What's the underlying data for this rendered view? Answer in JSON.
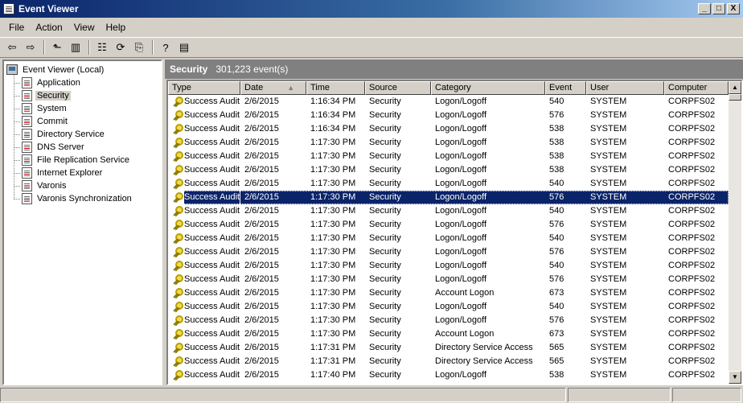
{
  "window": {
    "title": "Event Viewer",
    "controls": [
      "_",
      "□",
      "X"
    ]
  },
  "menu": [
    "File",
    "Action",
    "View",
    "Help"
  ],
  "toolbar": {
    "buttons": [
      {
        "name": "back-icon",
        "glyph": "⇦"
      },
      {
        "name": "forward-icon",
        "glyph": "⇨"
      },
      {
        "name": "up-folder-icon",
        "glyph": "⬑"
      },
      {
        "name": "show-hide-tree-icon",
        "glyph": "▥"
      },
      {
        "name": "properties-icon",
        "glyph": "☷"
      },
      {
        "name": "refresh-icon",
        "glyph": "⟳"
      },
      {
        "name": "export-list-icon",
        "glyph": "⎘"
      },
      {
        "name": "help-icon",
        "glyph": "?"
      },
      {
        "name": "description-pane-icon",
        "glyph": "▤"
      }
    ]
  },
  "tree": {
    "root": "Event Viewer (Local)",
    "items": [
      {
        "label": "Application",
        "selected": false
      },
      {
        "label": "Security",
        "selected": true
      },
      {
        "label": "System",
        "selected": false
      },
      {
        "label": "Commit",
        "selected": false
      },
      {
        "label": "Directory Service",
        "selected": false
      },
      {
        "label": "DNS Server",
        "selected": false
      },
      {
        "label": "File Replication Service",
        "selected": false
      },
      {
        "label": "Internet Explorer",
        "selected": false
      },
      {
        "label": "Varonis",
        "selected": false
      },
      {
        "label": "Varonis Synchronization",
        "selected": false
      }
    ]
  },
  "pane": {
    "name": "Security",
    "count": "301,223 event(s)"
  },
  "columns": [
    {
      "key": "type",
      "label": "Type",
      "cls": "w-type"
    },
    {
      "key": "date",
      "label": "Date",
      "cls": "w-date",
      "sort": "▲"
    },
    {
      "key": "time",
      "label": "Time",
      "cls": "w-time"
    },
    {
      "key": "source",
      "label": "Source",
      "cls": "w-source"
    },
    {
      "key": "category",
      "label": "Category",
      "cls": "w-category"
    },
    {
      "key": "event",
      "label": "Event",
      "cls": "w-event"
    },
    {
      "key": "user",
      "label": "User",
      "cls": "w-user"
    },
    {
      "key": "computer",
      "label": "Computer",
      "cls": "w-computer"
    }
  ],
  "rows": [
    {
      "type": "Success Audit",
      "date": "2/6/2015",
      "time": "1:16:34 PM",
      "source": "Security",
      "category": "Logon/Logoff",
      "event": "540",
      "user": "SYSTEM",
      "computer": "CORPFS02"
    },
    {
      "type": "Success Audit",
      "date": "2/6/2015",
      "time": "1:16:34 PM",
      "source": "Security",
      "category": "Logon/Logoff",
      "event": "576",
      "user": "SYSTEM",
      "computer": "CORPFS02"
    },
    {
      "type": "Success Audit",
      "date": "2/6/2015",
      "time": "1:16:34 PM",
      "source": "Security",
      "category": "Logon/Logoff",
      "event": "538",
      "user": "SYSTEM",
      "computer": "CORPFS02"
    },
    {
      "type": "Success Audit",
      "date": "2/6/2015",
      "time": "1:17:30 PM",
      "source": "Security",
      "category": "Logon/Logoff",
      "event": "538",
      "user": "SYSTEM",
      "computer": "CORPFS02"
    },
    {
      "type": "Success Audit",
      "date": "2/6/2015",
      "time": "1:17:30 PM",
      "source": "Security",
      "category": "Logon/Logoff",
      "event": "538",
      "user": "SYSTEM",
      "computer": "CORPFS02"
    },
    {
      "type": "Success Audit",
      "date": "2/6/2015",
      "time": "1:17:30 PM",
      "source": "Security",
      "category": "Logon/Logoff",
      "event": "538",
      "user": "SYSTEM",
      "computer": "CORPFS02"
    },
    {
      "type": "Success Audit",
      "date": "2/6/2015",
      "time": "1:17:30 PM",
      "source": "Security",
      "category": "Logon/Logoff",
      "event": "540",
      "user": "SYSTEM",
      "computer": "CORPFS02"
    },
    {
      "type": "Success Audit",
      "date": "2/6/2015",
      "time": "1:17:30 PM",
      "source": "Security",
      "category": "Logon/Logoff",
      "event": "576",
      "user": "SYSTEM",
      "computer": "CORPFS02",
      "selected": true
    },
    {
      "type": "Success Audit",
      "date": "2/6/2015",
      "time": "1:17:30 PM",
      "source": "Security",
      "category": "Logon/Logoff",
      "event": "540",
      "user": "SYSTEM",
      "computer": "CORPFS02"
    },
    {
      "type": "Success Audit",
      "date": "2/6/2015",
      "time": "1:17:30 PM",
      "source": "Security",
      "category": "Logon/Logoff",
      "event": "576",
      "user": "SYSTEM",
      "computer": "CORPFS02"
    },
    {
      "type": "Success Audit",
      "date": "2/6/2015",
      "time": "1:17:30 PM",
      "source": "Security",
      "category": "Logon/Logoff",
      "event": "540",
      "user": "SYSTEM",
      "computer": "CORPFS02"
    },
    {
      "type": "Success Audit",
      "date": "2/6/2015",
      "time": "1:17:30 PM",
      "source": "Security",
      "category": "Logon/Logoff",
      "event": "576",
      "user": "SYSTEM",
      "computer": "CORPFS02"
    },
    {
      "type": "Success Audit",
      "date": "2/6/2015",
      "time": "1:17:30 PM",
      "source": "Security",
      "category": "Logon/Logoff",
      "event": "540",
      "user": "SYSTEM",
      "computer": "CORPFS02"
    },
    {
      "type": "Success Audit",
      "date": "2/6/2015",
      "time": "1:17:30 PM",
      "source": "Security",
      "category": "Logon/Logoff",
      "event": "576",
      "user": "SYSTEM",
      "computer": "CORPFS02"
    },
    {
      "type": "Success Audit",
      "date": "2/6/2015",
      "time": "1:17:30 PM",
      "source": "Security",
      "category": "Account Logon",
      "event": "673",
      "user": "SYSTEM",
      "computer": "CORPFS02"
    },
    {
      "type": "Success Audit",
      "date": "2/6/2015",
      "time": "1:17:30 PM",
      "source": "Security",
      "category": "Logon/Logoff",
      "event": "540",
      "user": "SYSTEM",
      "computer": "CORPFS02"
    },
    {
      "type": "Success Audit",
      "date": "2/6/2015",
      "time": "1:17:30 PM",
      "source": "Security",
      "category": "Logon/Logoff",
      "event": "576",
      "user": "SYSTEM",
      "computer": "CORPFS02"
    },
    {
      "type": "Success Audit",
      "date": "2/6/2015",
      "time": "1:17:30 PM",
      "source": "Security",
      "category": "Account Logon",
      "event": "673",
      "user": "SYSTEM",
      "computer": "CORPFS02"
    },
    {
      "type": "Success Audit",
      "date": "2/6/2015",
      "time": "1:17:31 PM",
      "source": "Security",
      "category": "Directory Service Access",
      "event": "565",
      "user": "SYSTEM",
      "computer": "CORPFS02"
    },
    {
      "type": "Success Audit",
      "date": "2/6/2015",
      "time": "1:17:31 PM",
      "source": "Security",
      "category": "Directory Service Access",
      "event": "565",
      "user": "SYSTEM",
      "computer": "CORPFS02"
    },
    {
      "type": "Success Audit",
      "date": "2/6/2015",
      "time": "1:17:40 PM",
      "source": "Security",
      "category": "Logon/Logoff",
      "event": "538",
      "user": "SYSTEM",
      "computer": "CORPFS02"
    }
  ],
  "scrollbar": {
    "up_glyph": "▲",
    "down_glyph": "▼"
  },
  "colors": {
    "title_start": "#0a246a",
    "title_end": "#a6caf0",
    "selection": "#0a246a",
    "chrome": "#d4d0c8"
  }
}
